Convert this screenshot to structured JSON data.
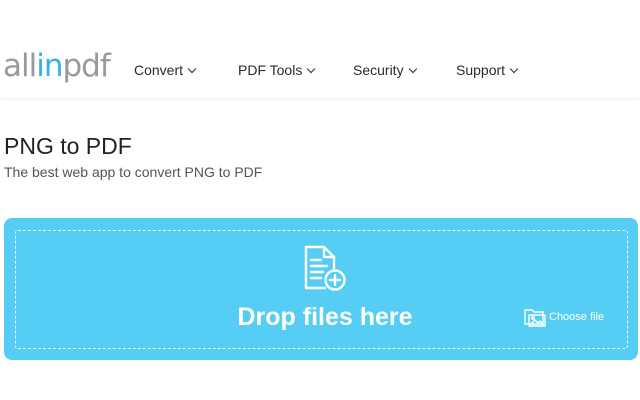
{
  "brand": {
    "logo_part1": "all",
    "logo_accent": "in",
    "logo_part2": "pdf",
    "logo_color": "#9a9a9a",
    "accent_color": "#3ab0ea"
  },
  "nav": {
    "items": [
      {
        "label": "Convert",
        "icon": "chevron-down-icon"
      },
      {
        "label": "PDF Tools",
        "icon": "chevron-down-icon"
      },
      {
        "label": "Security",
        "icon": "chevron-down-icon"
      },
      {
        "label": "Support",
        "icon": "chevron-down-icon"
      }
    ]
  },
  "page": {
    "title": "PNG to PDF",
    "subtitle": "The best web app to convert PNG to PDF"
  },
  "dropzone": {
    "label": "Drop files here",
    "icon": "file-add-icon",
    "background_color": "#55cdf5",
    "choose_file": {
      "label": "Choose file",
      "icon": "folder-image-icon"
    }
  }
}
